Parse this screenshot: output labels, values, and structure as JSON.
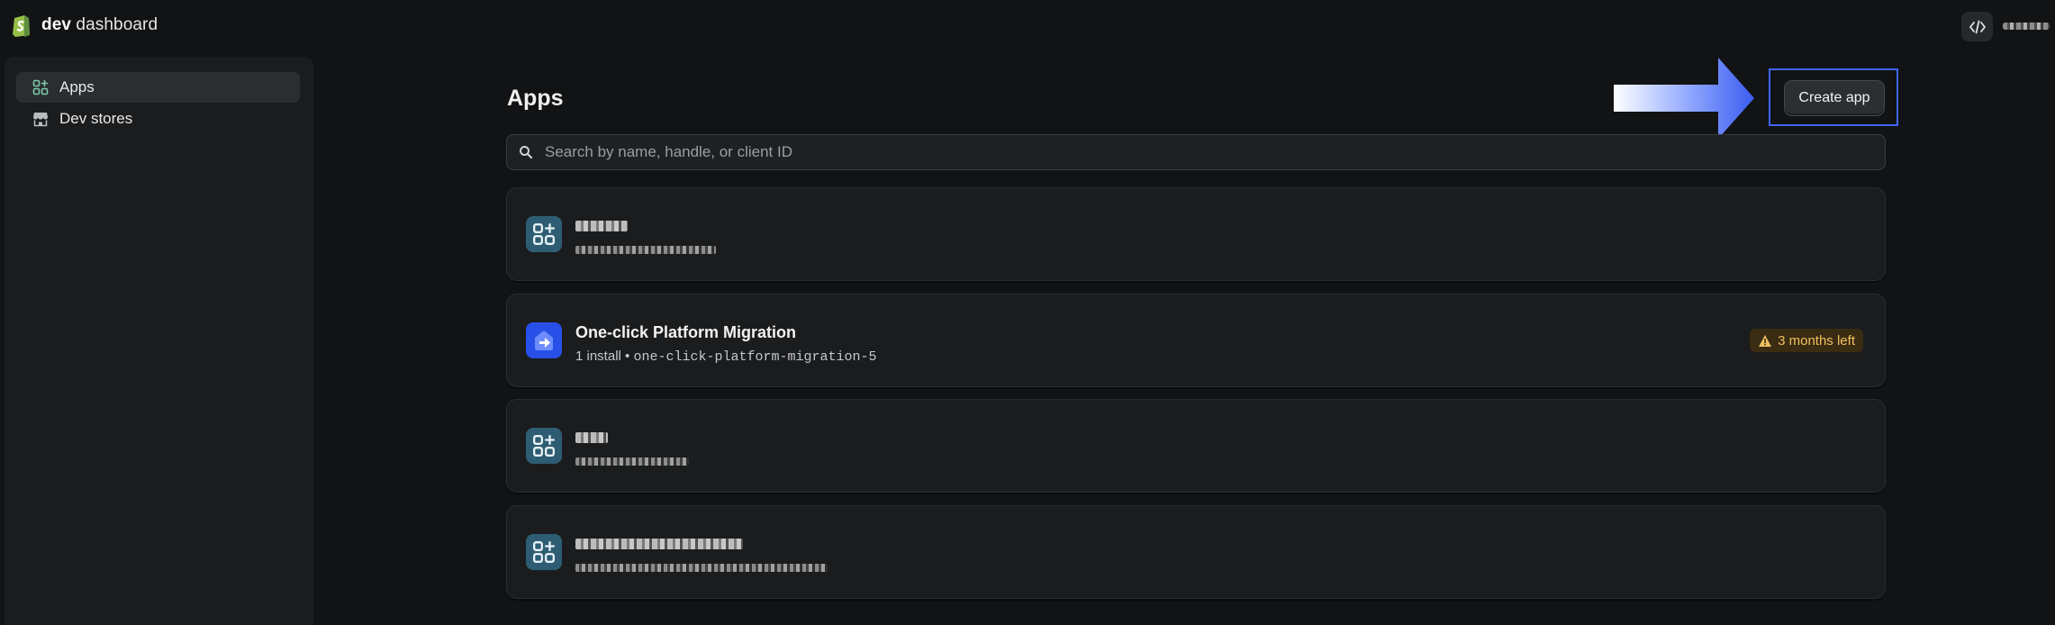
{
  "header": {
    "brand_bold": "dev",
    "brand_rest": " dashboard",
    "code_icon": "code-icon"
  },
  "sidebar": {
    "items": [
      {
        "label": "Apps",
        "icon": "apps-icon",
        "active": true
      },
      {
        "label": "Dev stores",
        "icon": "store-icon",
        "active": false
      }
    ]
  },
  "main": {
    "title": "Apps",
    "create_button": "Create app",
    "search_placeholder": "Search by name, handle, or client ID",
    "apps": [
      {
        "name": "",
        "meta": "",
        "icon": "apps-icon",
        "redacted": true
      },
      {
        "name": "One-click Platform Migration",
        "installs": "1 install",
        "separator": " • ",
        "handle": "one-click-platform-migration-5",
        "icon": "migration-icon",
        "badge": "3 months left"
      },
      {
        "name": "",
        "meta": "",
        "icon": "apps-icon",
        "redacted": true
      },
      {
        "name": "",
        "meta": "",
        "icon": "apps-icon",
        "redacted": true
      }
    ]
  },
  "colors": {
    "background": "#111315",
    "card": "#1a1c1e",
    "highlight": "#3f66f5",
    "warning": "#f0c060"
  }
}
